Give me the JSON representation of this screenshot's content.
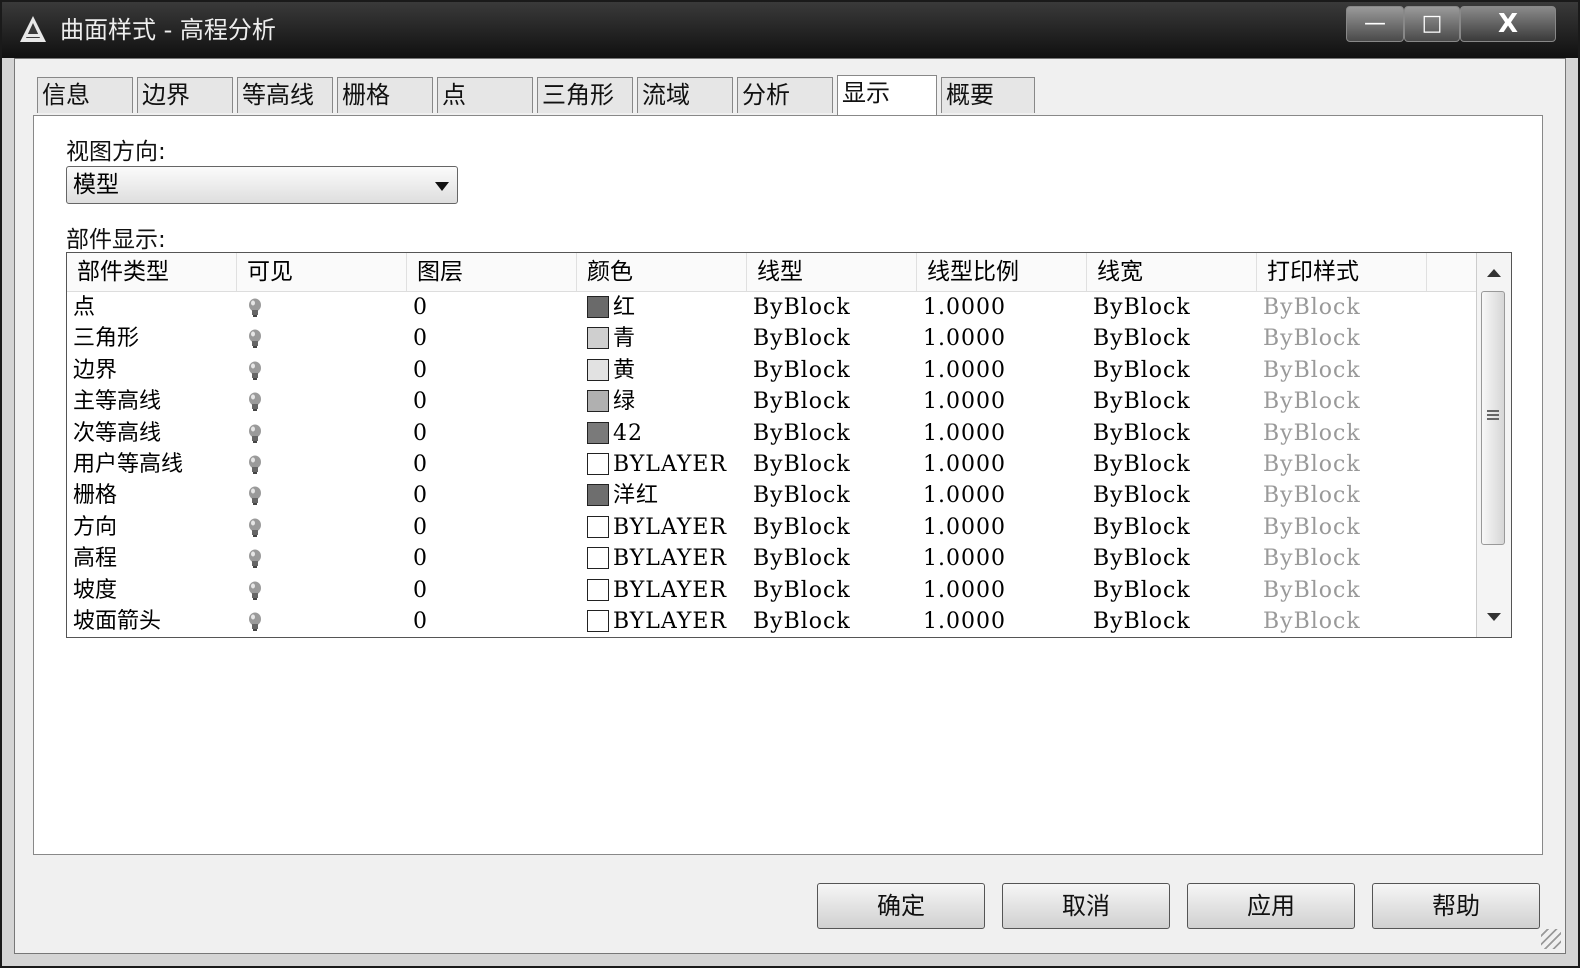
{
  "window": {
    "title": "曲面样式 - 高程分析"
  },
  "tabs": [
    {
      "label": "信息"
    },
    {
      "label": "边界"
    },
    {
      "label": "等高线"
    },
    {
      "label": "栅格"
    },
    {
      "label": "点"
    },
    {
      "label": "三角形"
    },
    {
      "label": "流域"
    },
    {
      "label": "分析"
    },
    {
      "label": "显示"
    },
    {
      "label": "概要"
    }
  ],
  "active_tab": "显示",
  "view_direction": {
    "label": "视图方向:",
    "selected": "模型"
  },
  "component_display": {
    "label": "部件显示:",
    "columns": [
      "部件类型",
      "可见",
      "图层",
      "颜色",
      "线型",
      "线型比例",
      "线宽",
      "打印样式"
    ],
    "rows": [
      {
        "type": "点",
        "layer": "0",
        "color": "红",
        "swatch": "#6a6a6a",
        "linetype": "ByBlock",
        "scale": "1.0000",
        "lineweight": "ByBlock",
        "plotstyle": "ByBlock"
      },
      {
        "type": "三角形",
        "layer": "0",
        "color": "青",
        "swatch": "#cfcfcf",
        "linetype": "ByBlock",
        "scale": "1.0000",
        "lineweight": "ByBlock",
        "plotstyle": "ByBlock"
      },
      {
        "type": "边界",
        "layer": "0",
        "color": "黄",
        "swatch": "#e2e2e2",
        "linetype": "ByBlock",
        "scale": "1.0000",
        "lineweight": "ByBlock",
        "plotstyle": "ByBlock"
      },
      {
        "type": "主等高线",
        "layer": "0",
        "color": "绿",
        "swatch": "#b0b0b0",
        "linetype": "ByBlock",
        "scale": "1.0000",
        "lineweight": "ByBlock",
        "plotstyle": "ByBlock"
      },
      {
        "type": "次等高线",
        "layer": "0",
        "color": "42",
        "swatch": "#7a7a7a",
        "linetype": "ByBlock",
        "scale": "1.0000",
        "lineweight": "ByBlock",
        "plotstyle": "ByBlock"
      },
      {
        "type": "用户等高线",
        "layer": "0",
        "color": "BYLAYER",
        "swatch": "#ffffff",
        "linetype": "ByBlock",
        "scale": "1.0000",
        "lineweight": "ByBlock",
        "plotstyle": "ByBlock"
      },
      {
        "type": "栅格",
        "layer": "0",
        "color": "洋红",
        "swatch": "#6e6e6e",
        "linetype": "ByBlock",
        "scale": "1.0000",
        "lineweight": "ByBlock",
        "plotstyle": "ByBlock"
      },
      {
        "type": "方向",
        "layer": "0",
        "color": "BYLAYER",
        "swatch": "#ffffff",
        "linetype": "ByBlock",
        "scale": "1.0000",
        "lineweight": "ByBlock",
        "plotstyle": "ByBlock"
      },
      {
        "type": "高程",
        "layer": "0",
        "color": "BYLAYER",
        "swatch": "#ffffff",
        "linetype": "ByBlock",
        "scale": "1.0000",
        "lineweight": "ByBlock",
        "plotstyle": "ByBlock"
      },
      {
        "type": "坡度",
        "layer": "0",
        "color": "BYLAYER",
        "swatch": "#ffffff",
        "linetype": "ByBlock",
        "scale": "1.0000",
        "lineweight": "ByBlock",
        "plotstyle": "ByBlock"
      },
      {
        "type": "坡面箭头",
        "layer": "0",
        "color": "BYLAYER",
        "swatch": "#ffffff",
        "linetype": "ByBlock",
        "scale": "1.0000",
        "lineweight": "ByBlock",
        "plotstyle": "ByBlock"
      }
    ]
  },
  "buttons": {
    "ok": "确定",
    "cancel": "取消",
    "apply": "应用",
    "help": "帮助"
  },
  "window_controls": {
    "minimize": "—",
    "maximize": "□",
    "close": "X"
  },
  "icons": {
    "visibility": "lightbulb-icon",
    "app": "autocad-logo-icon"
  }
}
